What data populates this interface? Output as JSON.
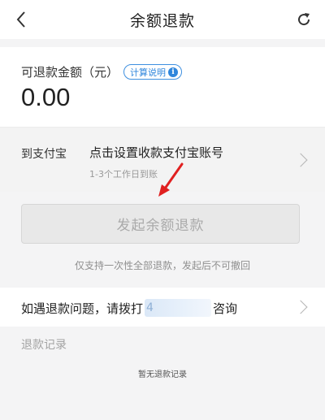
{
  "header": {
    "title": "余额退款",
    "back_icon": "chevron-left-icon",
    "refresh_icon": "refresh-icon"
  },
  "balance": {
    "label": "可退款金额（元）",
    "calc_link": "计算说明",
    "info_glyph": "i",
    "amount": "0.00"
  },
  "payout": {
    "label": "到支付宝",
    "value": "点击设置收款支付宝账号",
    "hint": "1-3个工作日到账"
  },
  "refund": {
    "button_label": "发起余额退款",
    "note": "仅支持一次性全部退款，发起后不可撤回"
  },
  "contact": {
    "prefix": "如遇退款问题，请拨打",
    "phone_visible": "4",
    "suffix": "咨询"
  },
  "records": {
    "title": "退款记录",
    "empty": "暂无退款记录"
  },
  "colors": {
    "accent": "#2f86dc",
    "annotation_arrow": "#e02020",
    "disabled_button": "#e8e8e8"
  }
}
